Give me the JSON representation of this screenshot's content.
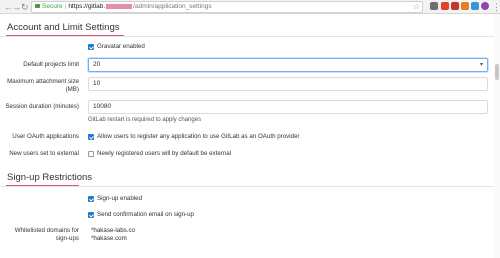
{
  "browser": {
    "secure_label": "Secure",
    "url_host": "https://gitlab.",
    "url_path": "/admin/application_settings",
    "icons": [
      "back-icon",
      "forward-icon",
      "reload-icon",
      "lock-icon",
      "bookmark-star-icon"
    ]
  },
  "account_section": {
    "title": "Account and Limit Settings",
    "gravatar_label": "Gravatar enabled",
    "gravatar_checked": true,
    "default_projects_limit": {
      "label": "Default projects limit",
      "value": "20"
    },
    "max_attachment_size": {
      "label_line1": "Maximum attachment size",
      "label_line2": "(MB)",
      "value": "10"
    },
    "session_duration": {
      "label": "Session duration (minutes)",
      "value": "10080",
      "help": "GitLab restart is required to apply changes"
    },
    "user_oauth": {
      "label": "User OAuth applications",
      "option": "Allow users to register any application to use GitLab as an OAuth provider",
      "checked": true
    },
    "new_users_external": {
      "label": "New users set to external",
      "option": "Newly registered users will by default be external",
      "checked": false
    }
  },
  "signup_section": {
    "title": "Sign-up Restrictions",
    "signup_enabled": {
      "label": "Sign-up enabled",
      "checked": true
    },
    "confirmation_email": {
      "label": "Send confirmation email on sign-up",
      "checked": true
    },
    "whitelisted_domains": {
      "label_line1": "Whitelisted domains for",
      "label_line2": "sign-ups",
      "values": [
        "*hakase-labs.co",
        "*hakase.com"
      ]
    }
  },
  "colors": {
    "accent": "#d5576f",
    "checkbox": "#1f78d1",
    "focus": "#73afea",
    "secure": "#3d9f46"
  }
}
